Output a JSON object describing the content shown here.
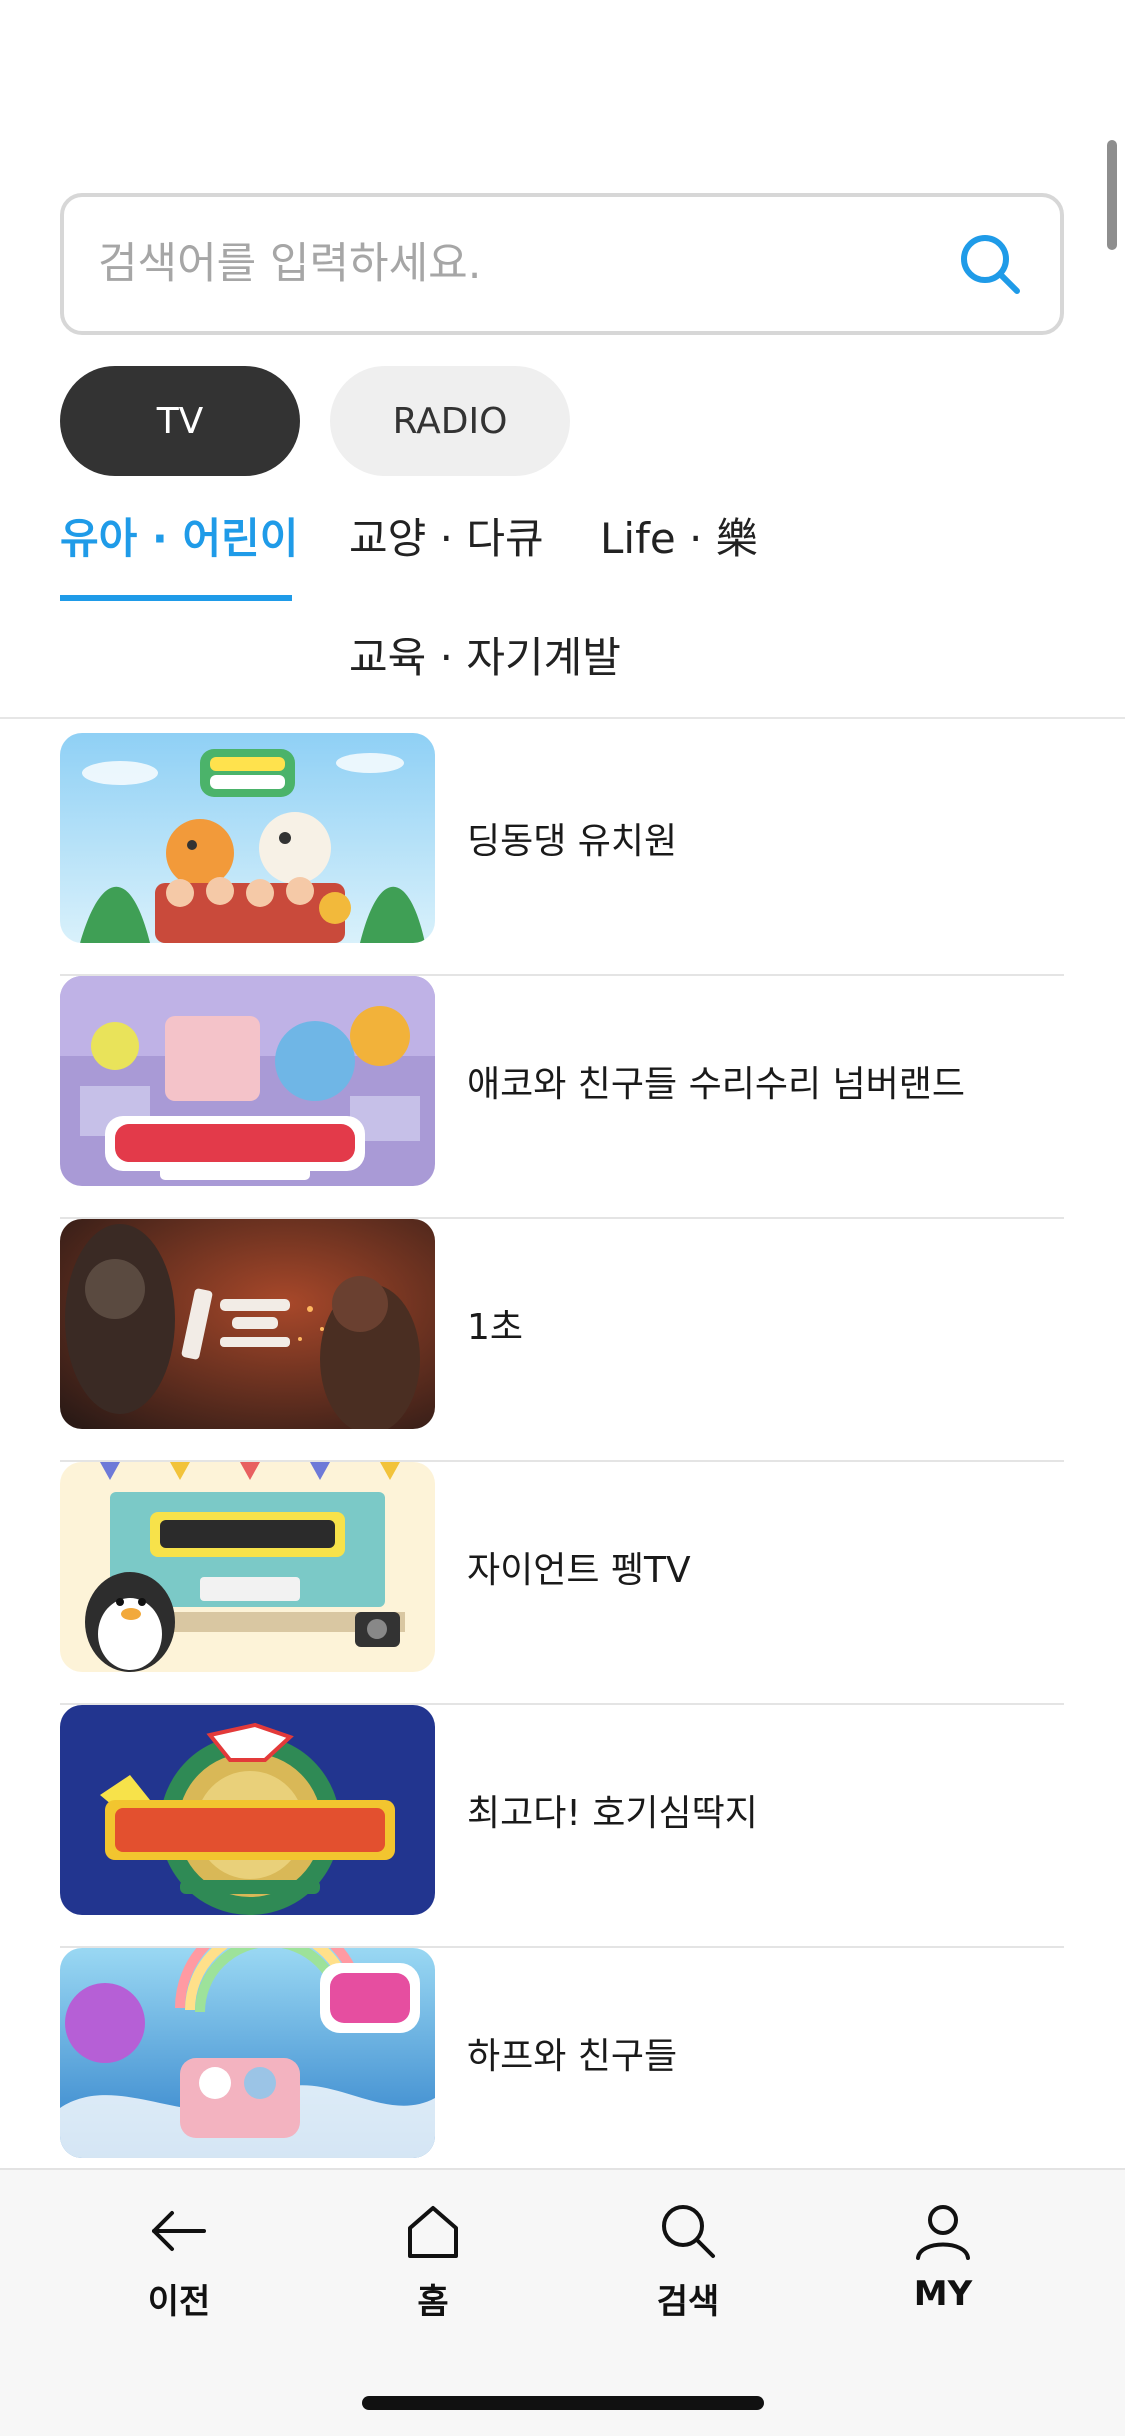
{
  "search": {
    "placeholder": "검색어를 입력하세요."
  },
  "media_toggle": [
    {
      "label": "TV",
      "selected": true
    },
    {
      "label": "RADIO",
      "selected": false
    }
  ],
  "category_tabs": [
    {
      "label": "유아 · 어린이",
      "selected": true
    },
    {
      "label": "교양 · 다큐",
      "selected": false
    },
    {
      "label": "Life · 樂",
      "selected": false
    },
    {
      "label": "교육 · 자기계발",
      "selected": false
    }
  ],
  "programs": [
    {
      "title": "딩동댕 유치원"
    },
    {
      "title": "애코와 친구들 수리수리 넘버랜드"
    },
    {
      "title": "1초"
    },
    {
      "title": "자이언트 펭TV"
    },
    {
      "title": "최고다! 호기심딱지"
    },
    {
      "title": "하프와 친구들"
    }
  ],
  "bottom_nav": [
    {
      "label": "이전",
      "icon": "back-arrow-icon"
    },
    {
      "label": "홈",
      "icon": "home-icon"
    },
    {
      "label": "검색",
      "icon": "search-icon"
    },
    {
      "label": "MY",
      "icon": "person-icon"
    }
  ],
  "colors": {
    "accent": "#1f9be8",
    "toggle_active_bg": "#333333",
    "toggle_inactive_bg": "#efefef"
  }
}
